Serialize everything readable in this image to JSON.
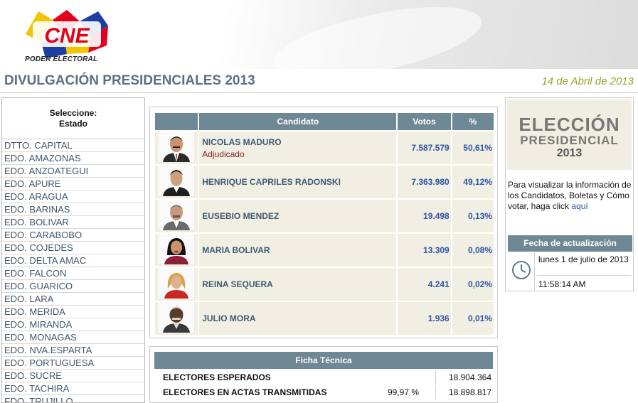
{
  "header": {
    "logo_text": "CNE",
    "logo_subtitle": "PODER ELECTORAL",
    "title": "DIVULGACIÓN PRESIDENCIALES 2013",
    "date": "14 de Abril de 2013"
  },
  "sidebar": {
    "heading_line1": "Seleccione:",
    "heading_line2": "Estado",
    "items": [
      "DTTO. CAPITAL",
      "EDO. AMAZONAS",
      "EDO. ANZOATEGUI",
      "EDO. APURE",
      "EDO. ARAGUA",
      "EDO. BARINAS",
      "EDO. BOLIVAR",
      "EDO. CARABOBO",
      "EDO. COJEDES",
      "EDO. DELTA AMAC",
      "EDO. FALCON",
      "EDO. GUARICO",
      "EDO. LARA",
      "EDO. MERIDA",
      "EDO. MIRANDA",
      "EDO. MONAGAS",
      "EDO. NVA.ESPARTA",
      "EDO. PORTUGUESA",
      "EDO. SUCRE",
      "EDO. TACHIRA",
      "EDO. TRUJILLO"
    ]
  },
  "results": {
    "columns": {
      "candidate": "Candidato",
      "votes": "Votos",
      "pct": "%"
    },
    "rows": [
      {
        "name": "NICOLAS MADURO",
        "tag": "Adjudicado",
        "votes": "7.587.579",
        "pct": "50,61%"
      },
      {
        "name": "HENRIQUE CAPRILES RADONSKI",
        "tag": "",
        "votes": "7.363.980",
        "pct": "49,12%"
      },
      {
        "name": "EUSEBIO MENDEZ",
        "tag": "",
        "votes": "19.498",
        "pct": "0,13%"
      },
      {
        "name": "MARIA BOLIVAR",
        "tag": "",
        "votes": "13.309",
        "pct": "0,08%"
      },
      {
        "name": "REINA SEQUERA",
        "tag": "",
        "votes": "4.241",
        "pct": "0,02%"
      },
      {
        "name": "JULIO MORA",
        "tag": "",
        "votes": "1.936",
        "pct": "0,01%"
      }
    ]
  },
  "ficha": {
    "title": "Ficha Técnica",
    "row1": {
      "label": "ELECTORES ESPERADOS",
      "pct": "",
      "value": "18.904.364"
    },
    "row2": {
      "label": "ELECTORES EN ACTAS TRANSMITIDAS",
      "pct": "99,97 %",
      "value": "18.898.817"
    }
  },
  "promo": {
    "banner_line1": "ELECCIÓN",
    "banner_line2": "PRESIDENCIAL",
    "banner_line3": "2013",
    "info_text": "Para visualizar la información de los Candidatos, Boletas y Cómo votar, haga click",
    "info_link": "aquí",
    "update_title": "Fecha de actualización",
    "update_date": "lunes 1 de julio de 2013",
    "update_time": "11:58:14 AM"
  },
  "colors": {
    "header_blue_gray": "#6f8896",
    "title_color": "#5a7185",
    "date_color": "#9aa22a",
    "adjudicado": "#8b1a1a",
    "numbers": "#2f54a7",
    "row_bg": "#f1efe3"
  }
}
